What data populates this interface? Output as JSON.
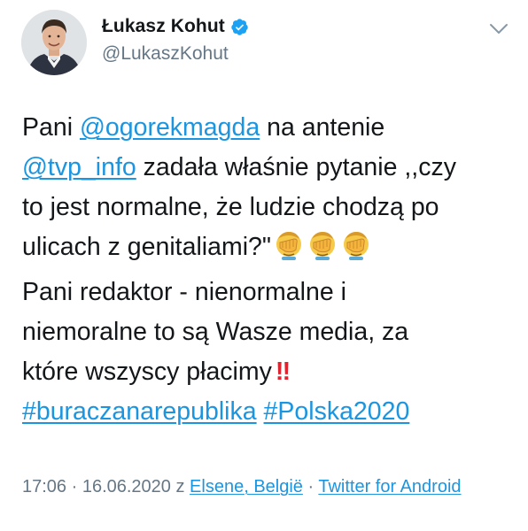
{
  "author": {
    "name": "Łukasz Kohut",
    "handle": "@LukaszKohut",
    "verified": true
  },
  "tweet": {
    "t1": "Pani ",
    "mention1": "@ogorekmagda",
    "t2": " na antenie",
    "mention2": "@tvp_info",
    "t3": " zadała właśnie pytanie ,,czy",
    "t4": "to jest normalne, że ludzie chodzą po",
    "t5": "ulicach z genitaliami?\"",
    "emoji_name": "face-palm-emoji",
    "emoji_count": 3,
    "t6": "Pani redaktor - nienormalne i",
    "t7": "niemoralne to są Wasze media, za",
    "t8": "które wszyscy płacimy",
    "bang": "‼",
    "hashtag1": "#buraczanarepublika",
    "hashtag2": "#Polska2020"
  },
  "meta": {
    "time": "17:06 · 16.06.2020 z ",
    "location": "Elsene, België",
    "sep": " · ",
    "source": "Twitter for Android"
  },
  "colors": {
    "link": "#1b95e0",
    "secondary": "#657786",
    "text": "#14171a",
    "verified": "#1da1f2",
    "bang": "#e0242f"
  }
}
